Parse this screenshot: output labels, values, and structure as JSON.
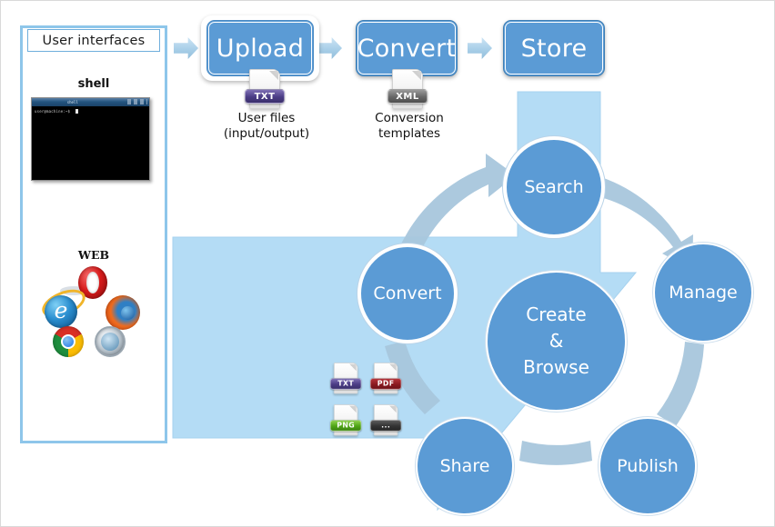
{
  "panel": {
    "title": "User interfaces",
    "shell_label": "shell",
    "web_label": "WEB",
    "terminal": {
      "prompt": "user@machine:~$",
      "titlebar": "shell"
    },
    "browsers": [
      {
        "name": "opera-icon"
      },
      {
        "name": "internet-explorer-icon"
      },
      {
        "name": "firefox-icon"
      },
      {
        "name": "chrome-icon"
      },
      {
        "name": "safari-icon"
      }
    ]
  },
  "flow": {
    "steps": [
      {
        "label": "Upload"
      },
      {
        "label": "Convert"
      },
      {
        "label": "Store"
      }
    ],
    "artifacts": [
      {
        "badge": "TXT",
        "caption_line1": "User files",
        "caption_line2": "(input/output)"
      },
      {
        "badge": "XML",
        "caption_line1": "Conversion",
        "caption_line2": "templates"
      }
    ]
  },
  "cycle": {
    "nodes": [
      {
        "label": "Search"
      },
      {
        "label": "Manage"
      },
      {
        "label": "Publish"
      },
      {
        "label": "Share"
      },
      {
        "label": "Convert"
      }
    ],
    "center": {
      "line1": "Create",
      "line2": "&",
      "line3": "Browse"
    }
  },
  "output_files": [
    {
      "badge": "TXT"
    },
    {
      "badge": "PDF"
    },
    {
      "badge": "PNG"
    },
    {
      "badge": "..."
    }
  ],
  "colors": {
    "node_blue": "#5b9bd5",
    "light_blue": "#b4dcf5",
    "arc_blue": "#a8c6dc",
    "panel_border": "#8ec6ea",
    "page_border": "#d9d9d9"
  }
}
